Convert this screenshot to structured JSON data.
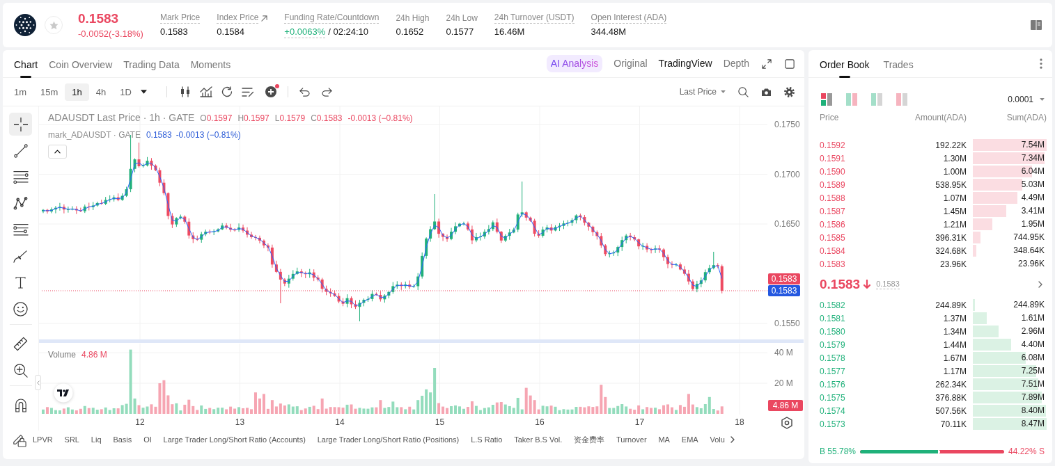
{
  "header": {
    "favorite": false,
    "price": "0.1583",
    "change": "-0.0052(-3.18%)",
    "falling": true,
    "stats": [
      {
        "label": "Mark Price",
        "underlined": true,
        "external": false,
        "positive": false,
        "value": "0.1583"
      },
      {
        "label": "Index Price",
        "underlined": true,
        "external": true,
        "positive": false,
        "value": "0.1584"
      },
      {
        "label": "Funding Rate/Countdown",
        "underlined": true,
        "external": false,
        "positive": true,
        "value": "+0.0063%",
        "extra": "/ 02:24:10"
      },
      {
        "label": "24h High",
        "underlined": false,
        "external": false,
        "positive": false,
        "value": "0.1652"
      },
      {
        "label": "24h Low",
        "underlined": false,
        "external": false,
        "positive": false,
        "value": "0.1577"
      },
      {
        "label": "24h Turnover (USDT)",
        "underlined": true,
        "external": false,
        "positive": false,
        "value": "16.46M"
      },
      {
        "label": "Open Interest (ADA)",
        "underlined": true,
        "external": false,
        "positive": false,
        "value": "344.48M"
      }
    ]
  },
  "chart_panel": {
    "tabs": [
      {
        "label": "Chart",
        "selected": true
      },
      {
        "label": "Coin Overview",
        "selected": false
      },
      {
        "label": "Trading Data",
        "selected": false
      },
      {
        "label": "Moments",
        "selected": false
      }
    ],
    "views": [
      {
        "label": "AI Analysis",
        "kind": "ai",
        "selected": false
      },
      {
        "label": "Original",
        "kind": "tab",
        "selected": false
      },
      {
        "label": "TradingView",
        "kind": "tab",
        "selected": true
      },
      {
        "label": "Depth",
        "kind": "tab",
        "selected": false
      }
    ],
    "intervals": [
      {
        "label": "1m",
        "selected": false
      },
      {
        "label": "15m",
        "selected": false
      },
      {
        "label": "1h",
        "selected": true
      },
      {
        "label": "4h",
        "selected": false
      },
      {
        "label": "1D",
        "selected": false
      }
    ],
    "price_source": "Last Price",
    "drawing_tool_groups": [
      [
        {
          "kind": "crosshair",
          "selected": true
        },
        {
          "kind": "trend_line",
          "selected": false
        },
        {
          "kind": "horizontal_lines",
          "selected": false
        },
        {
          "kind": "pattern",
          "selected": false
        },
        {
          "kind": "fib",
          "selected": false
        },
        {
          "kind": "brush",
          "selected": false
        },
        {
          "kind": "text",
          "selected": false
        },
        {
          "kind": "emoji",
          "selected": false
        }
      ],
      [
        {
          "kind": "ruler",
          "selected": false
        },
        {
          "kind": "zoom",
          "selected": false
        }
      ],
      [
        {
          "kind": "magnet",
          "selected": false
        }
      ]
    ],
    "legend": {
      "title": "ADAUSDT Last Price · 1h · GATE",
      "falling": true,
      "ohlc": [
        {
          "key": "O",
          "value": "0.1597"
        },
        {
          "key": "H",
          "value": "0.1597"
        },
        {
          "key": "L",
          "value": "0.1579"
        },
        {
          "key": "C",
          "value": "0.1583"
        }
      ],
      "change": "-0.0013 (−0.81%)"
    },
    "mark_legend": {
      "title": "mark_ADAUSDT · GATE",
      "value": "0.1583",
      "change": "-0.0013 (−0.81%)"
    },
    "price_axis": [
      "0.1750",
      "0.1700",
      "0.1650",
      "0.1550"
    ],
    "last_price_tag": "0.1583",
    "mark_price_tag": "0.1583",
    "volume_legend": {
      "label": "Volume",
      "value": "4.86 M"
    },
    "volume_axis": [
      "40 M",
      "20 M"
    ],
    "volume_tag": "4.86 M",
    "time_axis": [
      "12",
      "13",
      "14",
      "15",
      "16",
      "17",
      "18"
    ],
    "indicators": [
      "LPVR",
      "SRL",
      "Liq",
      "Basis",
      "OI",
      "Large Trader Long/Short Ratio (Accounts)",
      "Large Trader Long/Short Ratio (Positions)",
      "L.S Ratio",
      "Taker B.S Vol.",
      "资金费率",
      "Turnover",
      "MA",
      "EMA",
      "Volu"
    ]
  },
  "order_book": {
    "tabs": [
      {
        "label": "Order Book",
        "selected": true
      },
      {
        "label": "Trades",
        "selected": false
      }
    ],
    "view_modes": [
      {
        "kind": "split",
        "selected": true
      },
      {
        "kind": "both",
        "selected": false
      },
      {
        "kind": "bids",
        "selected": false
      },
      {
        "kind": "asks",
        "selected": false
      }
    ],
    "precision": "0.0001",
    "columns": [
      "Price",
      "Amount(ADA)",
      "Sum(ADA)"
    ],
    "asks": [
      {
        "price": "0.1592",
        "amount": "192.22K",
        "sum": "7.54M",
        "level": 1.0
      },
      {
        "price": "0.1591",
        "amount": "1.30M",
        "sum": "7.34M",
        "level": 0.97
      },
      {
        "price": "0.1590",
        "amount": "1.00M",
        "sum": "6.04M",
        "level": 0.8
      },
      {
        "price": "0.1589",
        "amount": "538.95K",
        "sum": "5.03M",
        "level": 0.67
      },
      {
        "price": "0.1588",
        "amount": "1.07M",
        "sum": "4.49M",
        "level": 0.6
      },
      {
        "price": "0.1587",
        "amount": "1.45M",
        "sum": "3.41M",
        "level": 0.45
      },
      {
        "price": "0.1586",
        "amount": "1.21M",
        "sum": "1.95M",
        "level": 0.26
      },
      {
        "price": "0.1585",
        "amount": "396.31K",
        "sum": "744.95K",
        "level": 0.1
      },
      {
        "price": "0.1584",
        "amount": "324.68K",
        "sum": "348.64K",
        "level": 0.05
      },
      {
        "price": "0.1583",
        "amount": "23.96K",
        "sum": "23.96K"
      }
    ],
    "last_price": "0.1583",
    "last_falling": true,
    "mark_price": "0.1583",
    "bids": [
      {
        "price": "0.1582",
        "amount": "244.89K",
        "sum": "244.89K",
        "level": 0.03
      },
      {
        "price": "0.1581",
        "amount": "1.37M",
        "sum": "1.61M",
        "level": 0.19
      },
      {
        "price": "0.1580",
        "amount": "1.34M",
        "sum": "2.96M",
        "level": 0.35
      },
      {
        "price": "0.1579",
        "amount": "1.44M",
        "sum": "4.40M",
        "level": 0.52
      },
      {
        "price": "0.1578",
        "amount": "1.67M",
        "sum": "6.08M",
        "level": 0.72
      },
      {
        "price": "0.1577",
        "amount": "1.17M",
        "sum": "7.25M",
        "level": 0.86
      },
      {
        "price": "0.1576",
        "amount": "262.34K",
        "sum": "7.51M",
        "level": 0.89
      },
      {
        "price": "0.1575",
        "amount": "376.88K",
        "sum": "7.89M",
        "level": 0.93
      },
      {
        "price": "0.1574",
        "amount": "507.56K",
        "sum": "8.40M",
        "level": 0.99
      },
      {
        "price": "0.1573",
        "amount": "70.11K",
        "sum": "8.47M",
        "level": 1.0
      }
    ],
    "ratio": {
      "buy_text": "B 55.78%",
      "sell_text": "44.22% S",
      "level": 0.5578
    }
  }
}
